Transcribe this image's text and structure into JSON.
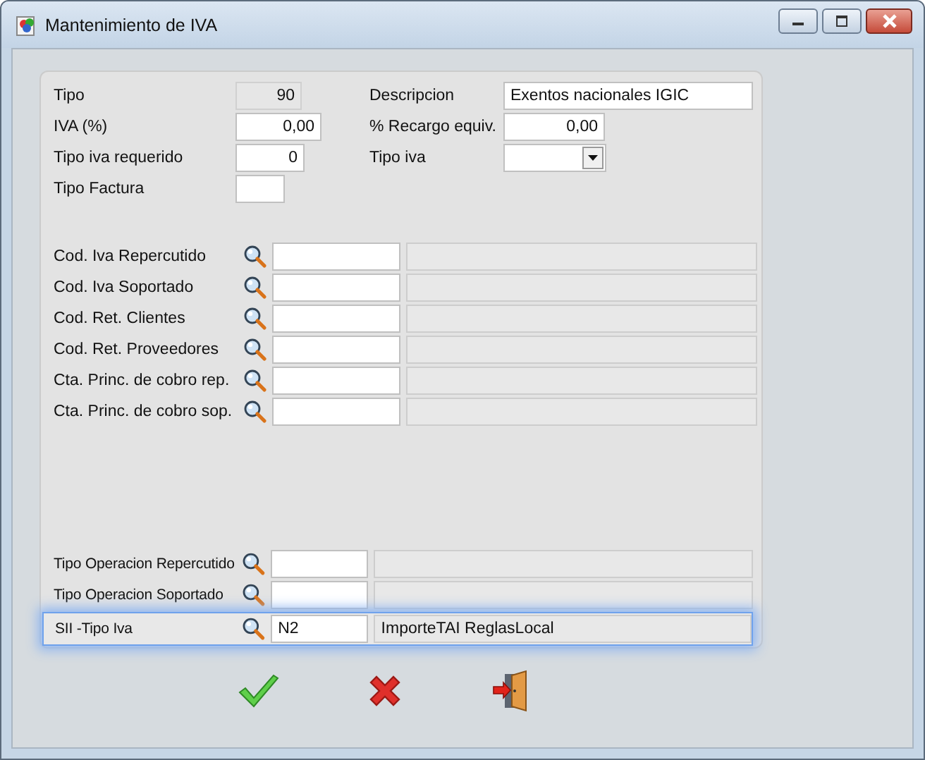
{
  "window": {
    "title": "Mantenimiento de IVA"
  },
  "left_fields": [
    {
      "label": "Tipo",
      "value": "90",
      "kind": "readonly_number"
    },
    {
      "label": "IVA (%)",
      "value": "0,00",
      "kind": "number"
    },
    {
      "label": "Tipo iva requerido",
      "value": "0",
      "kind": "number"
    },
    {
      "label": "Tipo Factura",
      "kind": "number"
    }
  ],
  "right_fields": [
    {
      "label": "Descripcion",
      "value": "Exentos nacionales IGIC",
      "kind": "text"
    },
    {
      "label": "% Recargo equiv.",
      "value": "0,00",
      "kind": "number"
    },
    {
      "label": "Tipo iva",
      "kind": "dropdown"
    }
  ],
  "lookups": [
    {
      "label": "Cod. Iva Repercutido"
    },
    {
      "label": "Cod. Iva Soportado"
    },
    {
      "label": "Cod. Ret. Clientes"
    },
    {
      "label": "Cod. Ret. Proveedores"
    },
    {
      "label": "Cta. Princ. de cobro  rep."
    },
    {
      "label": "Cta. Princ. de cobro  sop."
    }
  ],
  "operation_lookups": [
    {
      "label": "Tipo Operacion Repercutido",
      "selected": false
    },
    {
      "label": "Tipo Operacion Soportado",
      "selected": false
    },
    {
      "label": "SII -Tipo Iva",
      "code": "N2",
      "description": "ImporteTAI ReglasLocal",
      "selected": true
    }
  ],
  "actions": [
    {
      "kind": "accept"
    },
    {
      "kind": "cancel"
    },
    {
      "kind": "exit"
    }
  ]
}
